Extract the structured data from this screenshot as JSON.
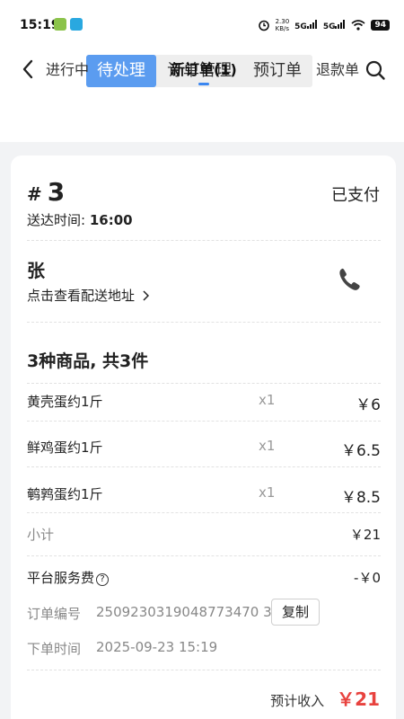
{
  "status_bar": {
    "time": "15:19",
    "net_speed_top": "2.30",
    "net_speed_bottom": "KB/s",
    "sim1": "5G",
    "sim2": "5G",
    "battery": "94"
  },
  "header": {
    "tabs": [
      {
        "label": "待处理",
        "active": true
      },
      {
        "label": "订单管理",
        "active": false
      },
      {
        "label": "预订单",
        "active": false
      }
    ],
    "accent": "#5b9cf0"
  },
  "subtabs": [
    {
      "label": "进行中"
    },
    {
      "label": "新订单(1)",
      "active": true
    },
    {
      "label": "退款单"
    }
  ],
  "order": {
    "hash": "#",
    "number": "3",
    "status": "已支付",
    "delivery_label": "送达时间:",
    "delivery_time": "16:00",
    "customer_name": "张",
    "address_link": "点击查看配送地址",
    "summary": "3种商品, 共3件",
    "items": [
      {
        "name": "黄壳蛋约1斤",
        "qty": "x1",
        "price": "￥6"
      },
      {
        "name": "鲜鸡蛋约1斤",
        "qty": "x1",
        "price": "￥6.5"
      },
      {
        "name": "鹌鹑蛋约1斤",
        "qty": "x1",
        "price": "￥8.5"
      }
    ],
    "subtotal_label": "小计",
    "subtotal_value": "￥21",
    "service_fee_label": "平台服务费",
    "service_fee_value": "-￥0",
    "order_no_label": "订单编号",
    "order_no": "2509230319048773470 3",
    "copy_label": "复制",
    "order_time_label": "下单时间",
    "order_time": "2025-09-23 15:19",
    "income_label": "预计收入",
    "income_value": "￥21",
    "price_color": "#e8423e"
  }
}
